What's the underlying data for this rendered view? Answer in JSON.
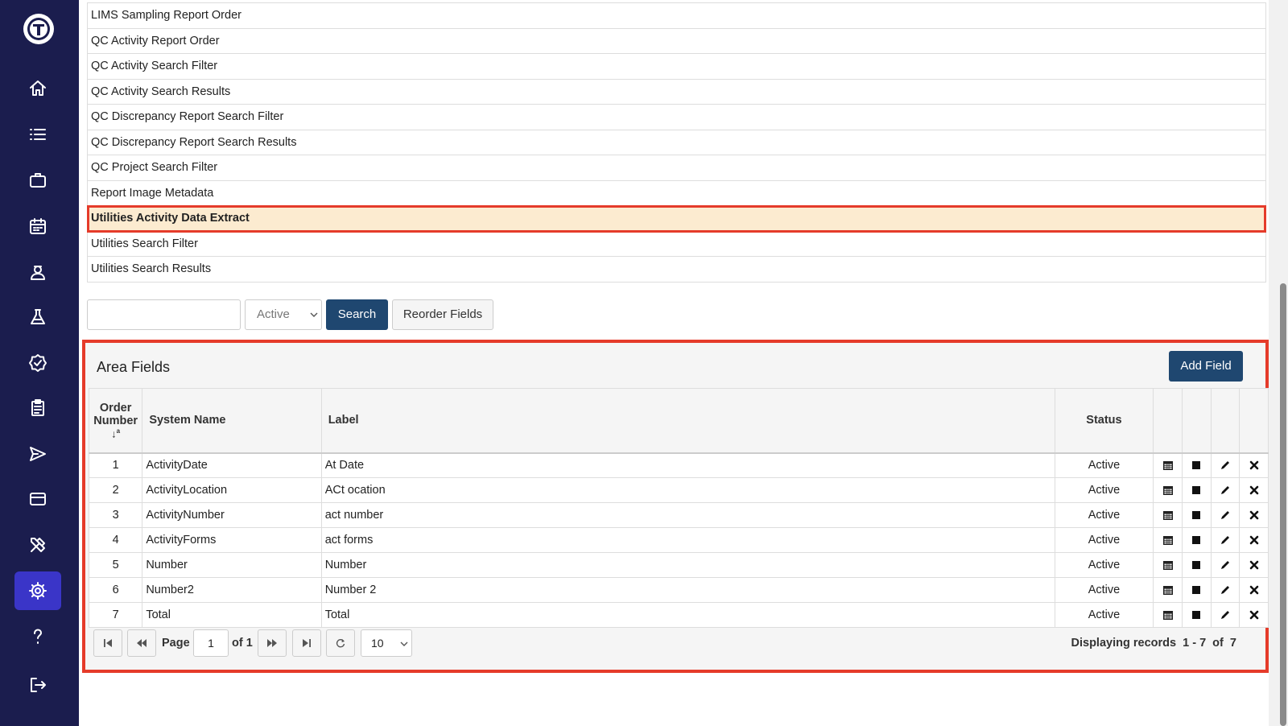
{
  "area_list": [
    "LIMS Sampling Report Order",
    "QC Activity Report Order",
    "QC Activity Search Filter",
    "QC Activity Search Results",
    "QC Discrepancy Report Search Filter",
    "QC Discrepancy Report Search Results",
    "QC Project Search Filter",
    "Report Image Metadata",
    "Utilities Activity Data Extract",
    "Utilities Search Filter",
    "Utilities Search Results"
  ],
  "filter": {
    "search_value": "",
    "status_selected": "Active",
    "search_label": "Search",
    "reorder_label": "Reorder Fields"
  },
  "panel": {
    "title": "Area Fields",
    "add_label": "Add Field"
  },
  "columns": {
    "order_line1": "Order",
    "order_line2": "Number",
    "system_name": "System Name",
    "label": "Label",
    "status": "Status"
  },
  "rows": [
    {
      "order": "1",
      "system_name": "ActivityDate",
      "label": "At Date",
      "status": "Active"
    },
    {
      "order": "2",
      "system_name": "ActivityLocation",
      "label": "ACt ocation",
      "status": "Active"
    },
    {
      "order": "3",
      "system_name": "ActivityNumber",
      "label": "act number",
      "status": "Active"
    },
    {
      "order": "4",
      "system_name": "ActivityForms",
      "label": "act forms",
      "status": "Active"
    },
    {
      "order": "5",
      "system_name": "Number",
      "label": "Number",
      "status": "Active"
    },
    {
      "order": "6",
      "system_name": "Number2",
      "label": "Number 2",
      "status": "Active"
    },
    {
      "order": "7",
      "system_name": "Total",
      "label": "Total",
      "status": "Active"
    }
  ],
  "pager": {
    "page_label": "Page",
    "page_value": "1",
    "of_label": "of 1",
    "page_size": "10",
    "display_text": "Displaying records  1 - 7  of  7"
  },
  "nav_icons": [
    "logo-icon",
    "home-icon",
    "list-icon",
    "briefcase-icon",
    "calendar-icon",
    "user-icon",
    "flask-icon",
    "badge-check-icon",
    "clipboard-icon",
    "send-icon",
    "credit-card-icon",
    "tools-icon",
    "gear-icon",
    "help-icon",
    "logout-icon"
  ],
  "colors": {
    "sidebar": "#1b1d4e",
    "active_nav": "#3a35c8",
    "primary": "#1f4770",
    "highlight_outline": "#e53b2a",
    "selected_row": "#fcebd0"
  }
}
